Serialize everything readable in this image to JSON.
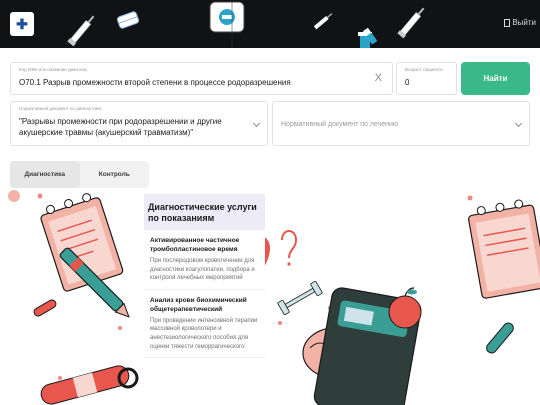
{
  "header": {
    "logo_icon": "medical-cross-icon",
    "exit_label": "Выйти"
  },
  "search": {
    "icd_label": "Код МКБ или название диагноза",
    "icd_value": "O70.1 Разрыв промежности второй степени в процессе родоразрешения",
    "clear_symbol": "X",
    "age_label": "Возраст пациента",
    "age_value": "0",
    "find_label": "Найти"
  },
  "filters": {
    "normdoc_label": "Нормативный документ по диагностике",
    "normdoc_value": "\"Разрывы промежности при родоразрешении и другие акушерские травмы (акушерский травматизм)\"",
    "normtreat_placeholder": "Нормативный документ по лечению"
  },
  "tabs": [
    {
      "label": "Диагностика",
      "active": true
    },
    {
      "label": "Контроль",
      "active": false
    }
  ],
  "panel": {
    "title": "Диагностические услуги по показаниям",
    "services": [
      {
        "name": "Активированное частичное тромбопластиновое время",
        "description": "При послеродовом кровотечении для диагностики коагулопатии, подбора и контроля лечебных мероприятий"
      },
      {
        "name": "Анализ крови биохимический общетерапевтический",
        "description": "При проведении интенсивной терапии массивной кровопотери и анестезиологического пособия для оценки тяжести геморрагического"
      }
    ]
  },
  "colors": {
    "header_bg": "#111214",
    "accent_green": "#3ab88a",
    "panel_head_bg": "#ecebf7",
    "illus_red": "#e8574e",
    "illus_teal": "#3a9e95"
  }
}
